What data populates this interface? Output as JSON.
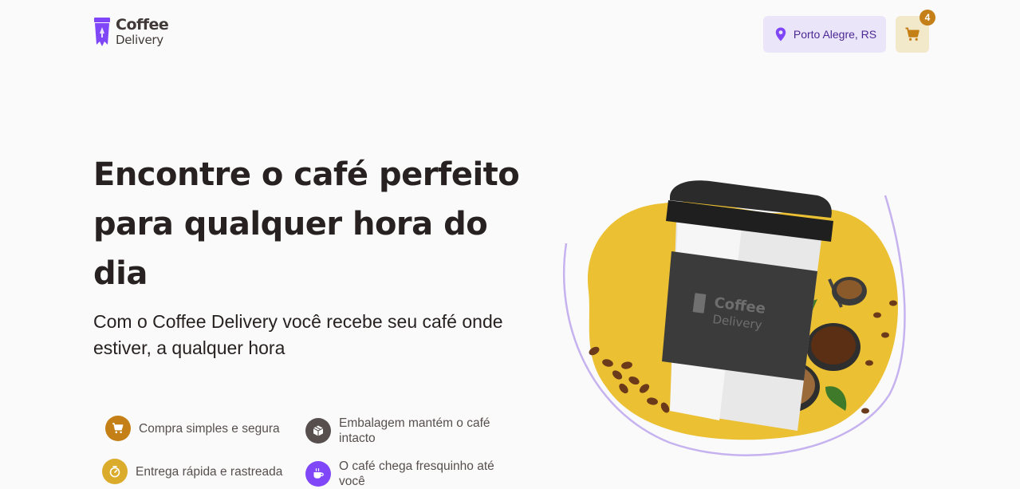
{
  "header": {
    "logo": {
      "line1": "Coffee",
      "line2": "Delivery"
    },
    "location": {
      "label": "Porto Alegre, RS",
      "icon": "map-pin-icon"
    },
    "cart": {
      "icon": "shopping-cart-icon",
      "count": "4"
    }
  },
  "hero": {
    "title": "Encontre o café perfeito para qualquer hora do dia",
    "subtitle": "Com o Coffee Delivery você recebe seu café onde estiver, a qualquer hora",
    "image_cup_text": {
      "line1": "Coffee",
      "line2": "Delivery"
    }
  },
  "features": [
    {
      "label": "Compra simples e segura",
      "icon": "shopping-cart-icon",
      "color": "#c47f17"
    },
    {
      "label": "Entrega rápida e rastreada",
      "icon": "timer-icon",
      "color": "#dbac2c"
    },
    {
      "label": "Embalagem mantém o café intacto",
      "icon": "package-icon",
      "color": "#574f4d"
    },
    {
      "label": "O café chega fresquinho até você",
      "icon": "coffee-icon",
      "color": "#8047f8"
    }
  ],
  "colors": {
    "purple": "#8047f8",
    "purple_dark": "#4b2995",
    "purple_light": "#ebe5f9",
    "yellow": "#dbac2c",
    "yellow_dark": "#c47f17",
    "yellow_light": "#f1e9c9",
    "background": "#fafafa"
  }
}
